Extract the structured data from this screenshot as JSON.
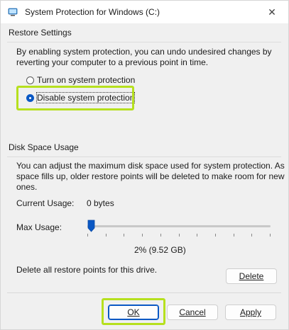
{
  "window": {
    "title": "System Protection for Windows (C:)",
    "close_glyph": "✕"
  },
  "restore_settings": {
    "group_label": "Restore Settings",
    "description_line1": "By enabling system protection, you can undo undesired changes by",
    "description_line2": "reverting your computer to a previous point in time.",
    "options": [
      {
        "label": "Turn on system protection",
        "selected": false
      },
      {
        "label": "Disable system protection",
        "selected": true
      }
    ]
  },
  "disk_space": {
    "group_label": "Disk Space Usage",
    "description_line1": "You can adjust the maximum disk space used for system protection. As",
    "description_line2": "space fills up, older restore points will be deleted to make room for new",
    "description_line3": "ones.",
    "current_usage_label": "Current Usage:",
    "current_usage_value": "0 bytes",
    "max_usage_label": "Max Usage:",
    "max_usage_value": "2% (9.52 GB)",
    "max_usage_percent": 2,
    "delete_text": "Delete all restore points for this drive.",
    "delete_button": "Delete"
  },
  "buttons": {
    "ok": "OK",
    "cancel": "Cancel",
    "apply": "Apply"
  },
  "colors": {
    "accent": "#0a58c4",
    "highlight": "#b6e01e"
  }
}
